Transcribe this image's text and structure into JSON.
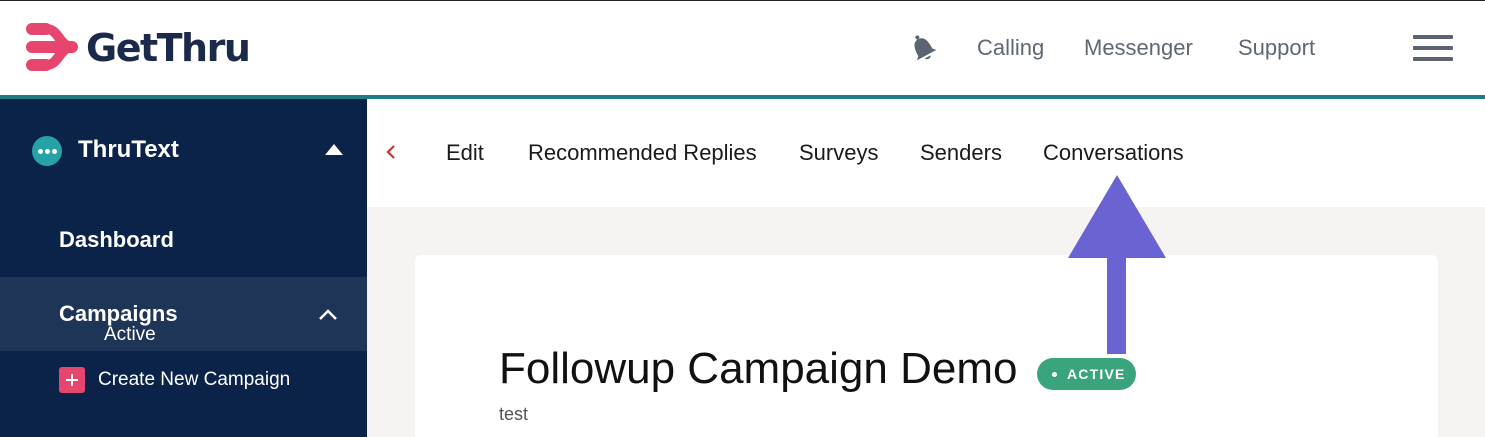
{
  "header": {
    "logo_text": "GetThru",
    "nav": [
      "Calling",
      "Messenger",
      "Support"
    ],
    "icons": {
      "notifications": "bell-icon",
      "menu": "hamburger-menu-icon"
    },
    "colors": {
      "brand_pink": "#e6466e",
      "brand_navy": "#1b2a4a",
      "teal_rule": "#1f7c84"
    }
  },
  "sidebar": {
    "product": "ThruText",
    "items": [
      {
        "label": "Dashboard"
      },
      {
        "label": "Campaigns",
        "expanded": true
      },
      {
        "label": "Create New Campaign"
      },
      {
        "label": "Active"
      }
    ],
    "colors": {
      "background": "#0b2348",
      "selected": "#1e3557"
    }
  },
  "subnav": {
    "tabs": [
      "Edit",
      "Recommended Replies",
      "Surveys",
      "Senders",
      "Conversations"
    ]
  },
  "campaign": {
    "title": "Followup Campaign Demo",
    "status": "ACTIVE",
    "subtitle": "test",
    "status_color": "#3aa57c"
  },
  "annotation": {
    "color": "#6b63d1",
    "points_to": "Conversations"
  }
}
